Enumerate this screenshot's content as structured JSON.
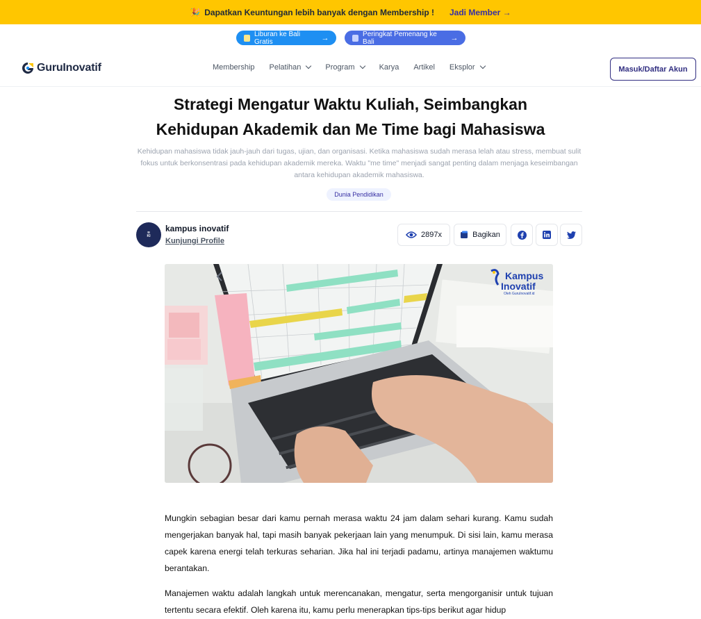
{
  "promo": {
    "text": "Dapatkan Keuntungan lebih banyak dengan Membership !",
    "cta": "Jadi Member →"
  },
  "pills": [
    {
      "label": "Liburan ke Bali Gratis",
      "arrow": "→",
      "icon": "palm-icon"
    },
    {
      "label": "Peringkat Pemenang ke Bali",
      "arrow": "→",
      "icon": "chart-icon"
    }
  ],
  "nav": {
    "brand": "GuruInovatif",
    "items": [
      {
        "label": "Membership",
        "dropdown": false
      },
      {
        "label": "Pelatihan",
        "dropdown": true
      },
      {
        "label": "Program",
        "dropdown": true
      },
      {
        "label": "Karya",
        "dropdown": false
      },
      {
        "label": "Artikel",
        "dropdown": false
      },
      {
        "label": "Eksplor",
        "dropdown": true
      }
    ],
    "login": "Masuk/Daftar Akun"
  },
  "article": {
    "title_line1": "Strategi Mengatur Waktu Kuliah, Seimbangkan",
    "title_line2": "Kehidupan Akademik dan Me Time bagi Mahasiswa",
    "excerpt": "Kehidupan mahasiswa tidak jauh-jauh dari tugas, ujian, dan organisasi. Ketika mahasiswa sudah merasa lelah atau stress, membuat sulit fokus untuk berkonsentrasi pada kehidupan akademik mereka. Waktu \"me time\" menjadi sangat penting dalam menjaga keseimbangan antara kehidupan akademik mahasiswa.",
    "tag": "Dunia Pendidikan",
    "author": "kampus inovatif",
    "visit_profile": "Kunjungi Profile",
    "views": "2897x",
    "share": "Bagikan",
    "hero_watermark_1": "Kampus",
    "hero_watermark_2": "Inovatif",
    "hero_watermark_sub": "Oleh GuruInovatif.id",
    "paragraphs": [
      "Mungkin sebagian besar dari kamu pernah merasa waktu 24 jam dalam sehari kurang. Kamu sudah mengerjakan banyak hal, tapi masih banyak pekerjaan lain yang menumpuk. Di sisi lain, kamu merasa capek karena energi telah terkuras seharian. Jika hal ini terjadi padamu, artinya manajemen waktumu berantakan.",
      "Manajemen waktu adalah langkah untuk merencanakan, mengatur, serta mengorganisir untuk tujuan tertentu secara efektif. Oleh karena itu, kamu perlu menerapkan tips-tips berikut agar hidup"
    ]
  },
  "colors": {
    "promo_bg": "#ffc600",
    "accent": "#312e81",
    "pill_blue": "#1e8ff2",
    "pill_indigo": "#4a6de4"
  }
}
